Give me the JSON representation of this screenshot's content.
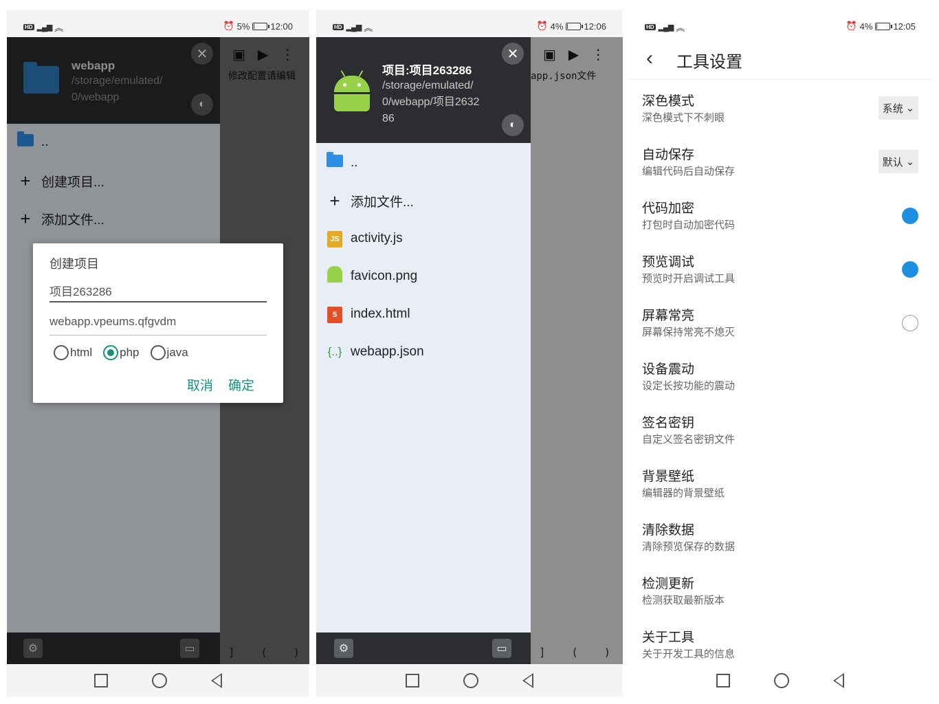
{
  "phone1": {
    "status": {
      "battery": "5%",
      "time": "12:00",
      "battery_level": 0.05
    },
    "drawer": {
      "title": "webapp",
      "path": "/storage/emulated/0/webapp",
      "path_lines": [
        "/storage/emulated/",
        "0/webapp"
      ],
      "items": [
        {
          "label": "..",
          "icon": "folder-icon"
        },
        {
          "label": "创建项目...",
          "icon": "plus-icon"
        },
        {
          "label": "添加文件...",
          "icon": "plus-icon"
        }
      ]
    },
    "editor_hint": "修改配置请编辑",
    "dialog": {
      "title": "创建项目",
      "name_value": "项目263286",
      "package_value": "webapp.vpeums.qfgvdm",
      "options": [
        "html",
        "php",
        "java"
      ],
      "selected": "php",
      "cancel": "取消",
      "confirm": "确定"
    },
    "editor_bottom": "] ( )"
  },
  "phone2": {
    "status": {
      "battery": "4%",
      "time": "12:06",
      "battery_level": 0.04
    },
    "drawer": {
      "title": "项目:项目263286",
      "path_lines": [
        "/storage/emulated/",
        "0/webapp/项目2632",
        "86"
      ],
      "items": [
        {
          "label": "..",
          "icon": "folder-icon"
        },
        {
          "label": "添加文件...",
          "icon": "plus-icon"
        },
        {
          "label": "activity.js",
          "icon": "js-file-icon"
        },
        {
          "label": "favicon.png",
          "icon": "android-icon"
        },
        {
          "label": "index.html",
          "icon": "html5-icon"
        },
        {
          "label": "webapp.json",
          "icon": "json-icon"
        }
      ]
    },
    "editor_hint": "app.json文件",
    "editor_bottom": "] ( ) :"
  },
  "phone3": {
    "status": {
      "battery": "4%",
      "time": "12:05",
      "battery_level": 0.04
    },
    "title": "工具设置",
    "settings": [
      {
        "label": "深色模式",
        "desc": "深色模式下不刺眼",
        "control": "dropdown",
        "value": "系统"
      },
      {
        "label": "自动保存",
        "desc": "编辑代码后自动保存",
        "control": "dropdown",
        "value": "默认"
      },
      {
        "label": "代码加密",
        "desc": "打包时自动加密代码",
        "control": "toggle",
        "on": true
      },
      {
        "label": "预览调试",
        "desc": "预览时开启调试工具",
        "control": "toggle",
        "on": true
      },
      {
        "label": "屏幕常亮",
        "desc": "屏幕保持常亮不熄灭",
        "control": "toggle",
        "on": false
      },
      {
        "label": "设备震动",
        "desc": "设定长按功能的震动",
        "control": "none"
      },
      {
        "label": "签名密钥",
        "desc": "自定义签名密钥文件",
        "control": "none"
      },
      {
        "label": "背景壁纸",
        "desc": "编辑器的背景壁纸",
        "control": "none"
      },
      {
        "label": "清除数据",
        "desc": "清除预览保存的数据",
        "control": "none"
      },
      {
        "label": "检测更新",
        "desc": "检测获取最新版本",
        "control": "none"
      },
      {
        "label": "关于工具",
        "desc": "关于开发工具的信息",
        "control": "none"
      }
    ]
  },
  "colors": {
    "accent": "#14907a",
    "toggle_on": "#1d8fe0",
    "drawer_head": "#2b2d30",
    "folder": "#2d8ee8"
  }
}
